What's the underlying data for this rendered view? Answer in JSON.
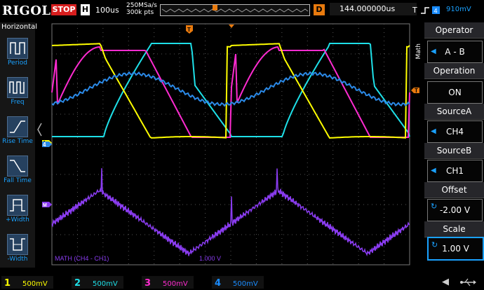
{
  "header": {
    "logo": "RIGOL",
    "run_status": "STOP",
    "timebase_label": "H",
    "timebase_value": "100us",
    "sample_rate": "250MSa/s",
    "memory_depth": "300k pts",
    "delay_label": "D",
    "delay_value": "144.000000us",
    "trigger_label": "T",
    "trigger_level": "910mV"
  },
  "left_menu": {
    "title": "Horizontal",
    "items": [
      {
        "label": "Period",
        "icon": "period-icon"
      },
      {
        "label": "Freq",
        "icon": "freq-icon"
      },
      {
        "label": "Rise Time",
        "icon": "rise-time-icon"
      },
      {
        "label": "Fall Time",
        "icon": "fall-time-icon"
      },
      {
        "label": "+Width",
        "icon": "positive-width-icon"
      },
      {
        "label": "-Width",
        "icon": "negative-width-icon"
      }
    ]
  },
  "right_menu": {
    "side_label": "Math",
    "items": [
      {
        "title": "Operator",
        "value": "A - B"
      },
      {
        "title": "Operation",
        "value": "ON"
      },
      {
        "title": "SourceA",
        "value": "CH4"
      },
      {
        "title": "SourceB",
        "value": "CH1"
      },
      {
        "title": "Offset",
        "value": "-2.00 V"
      },
      {
        "title": "Scale",
        "value": "1.00 V"
      }
    ]
  },
  "screen": {
    "math_label": "MATH  (CH4 - CH1)",
    "math_scale": "1.000 V",
    "channel_markers": [
      "1",
      "4",
      "M"
    ]
  },
  "channels": [
    {
      "id": "1",
      "scale": "500mV",
      "color": "#ffff00"
    },
    {
      "id": "2",
      "scale": "500mV",
      "color": "#00e5ff"
    },
    {
      "id": "3",
      "scale": "500mV",
      "color": "#ff2bd0"
    },
    {
      "id": "4",
      "scale": "500mV",
      "color": "#1a8cff"
    }
  ],
  "colors": {
    "ch1": "#ffff00",
    "ch2": "#1ee0e8",
    "ch3": "#ff2bd0",
    "ch4": "#2b8ae8",
    "math": "#8a3cf0",
    "accent": "#1aa1ff",
    "trigger": "#e87a0e"
  }
}
